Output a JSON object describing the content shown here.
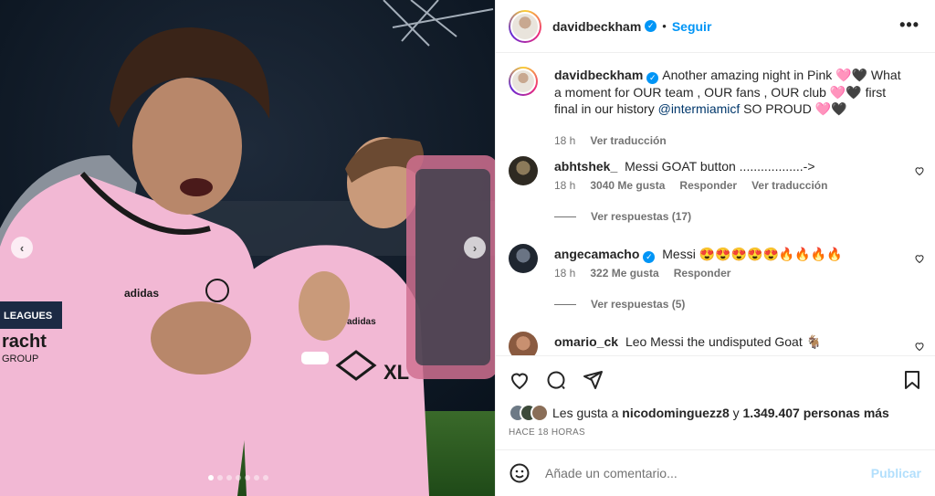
{
  "post": {
    "author": "davidbeckham",
    "follow_label": "Seguir",
    "separator": "•",
    "more_label": "•••"
  },
  "caption": {
    "username": "davidbeckham",
    "text_part1": "Another amazing night in Pink 🩷🖤 What a moment for OUR team , OUR fans , OUR club 🩷🖤 first final in our history",
    "mention": "@intermiamicf",
    "text_part2": "SO PROUD 🩷🖤",
    "time": "18 h",
    "translate": "Ver traducción"
  },
  "comments": [
    {
      "username": "abhtshek_",
      "text": "Messi GOAT button ..................->",
      "time": "18 h",
      "likes": "3040 Me gusta",
      "reply": "Responder",
      "translate": "Ver traducción",
      "view_replies": "Ver respuestas (17)"
    },
    {
      "username": "angecamacho",
      "verified": true,
      "text": "Messi 😍😍😍😍😍🔥🔥🔥🔥",
      "time": "18 h",
      "likes": "322 Me gusta",
      "reply": "Responder",
      "view_replies": "Ver respuestas (5)"
    },
    {
      "username": "omario_ck",
      "text": "Leo Messi the undisputed Goat 🐐"
    }
  ],
  "likes_summary": {
    "prefix": "Les gusta a",
    "user": "nicodominguezz8",
    "middle": "y",
    "count": "1.349.407 personas más"
  },
  "timestamp": "HACE 18 HORAS",
  "compose": {
    "placeholder": "Añade un comentario...",
    "publish_label": "Publicar"
  },
  "colors": {
    "accent": "#0095f6",
    "jersey_pink": "#f2b8d4",
    "muted": "#737373"
  },
  "icons": [
    "heart-icon",
    "comment-icon",
    "share-icon",
    "bookmark-icon",
    "emoji-icon",
    "verified-icon",
    "more-icon"
  ]
}
